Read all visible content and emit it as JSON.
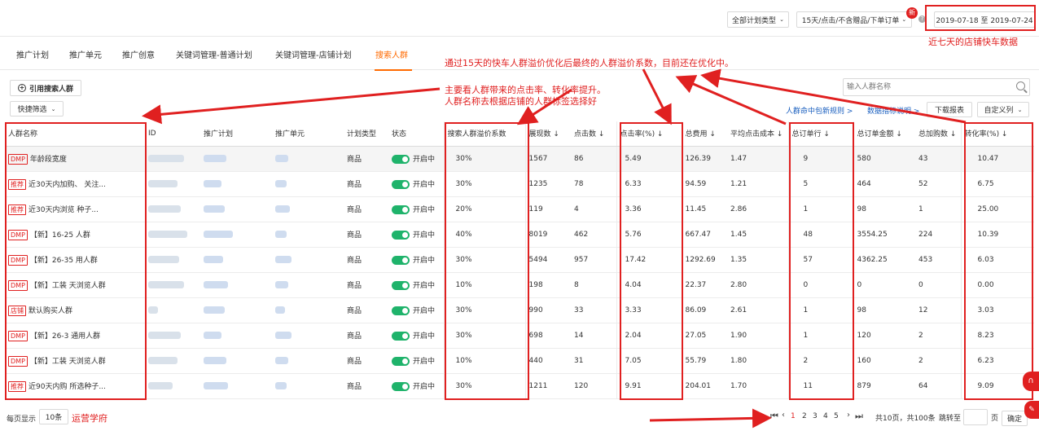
{
  "topbar": {
    "plan_type_select": "全部计划类型",
    "metric_select": "15天/点击/不含赠品/下单订单",
    "new_badge": "新",
    "date_range": "2019-07-18 至 2019-07-24"
  },
  "tabs": [
    "推广计划",
    "推广单元",
    "推广创意",
    "关键词管理-普通计划",
    "关键词管理-店铺计划",
    "搜索人群"
  ],
  "toolbar": {
    "quote_button": "引用搜索人群",
    "quick_filter": "快捷筛选",
    "search_placeholder": "输入人群名称",
    "link_rules": "人群命中包新规则 >",
    "link_metrics": "数据指标说明 >",
    "download_report": "下载报表",
    "custom_columns": "自定义列"
  },
  "table": {
    "headers": [
      "人群名称",
      "ID",
      "推广计划",
      "推广单元",
      "计划类型",
      "状态",
      "搜索人群溢价系数",
      "展现数 ↓",
      "点击数 ↓",
      "点击率(%) ↓",
      "总费用 ↓",
      "平均点击成本 ↓",
      "总订单行 ↓",
      "总订单金额 ↓",
      "总加购数 ↓",
      "转化率(%) ↓"
    ],
    "rows": [
      {
        "tag": "DMP",
        "name": "年龄段宽度",
        "type": "商品",
        "status": "开启中",
        "premium": "30%",
        "impressions": "1567",
        "clicks": "86",
        "ctr": "5.49",
        "cost": "126.39",
        "cpc": "1.47",
        "orders": "9",
        "amount": "580",
        "carts": "43",
        "cvr": "10.47"
      },
      {
        "tag": "推荐",
        "name": "近30天内加购、 关注...",
        "type": "商品",
        "status": "开启中",
        "premium": "30%",
        "impressions": "1235",
        "clicks": "78",
        "ctr": "6.33",
        "cost": "94.59",
        "cpc": "1.21",
        "orders": "5",
        "amount": "464",
        "carts": "52",
        "cvr": "6.75"
      },
      {
        "tag": "推荐",
        "name": "近30天内浏览 种子...",
        "type": "商品",
        "status": "开启中",
        "premium": "20%",
        "impressions": "119",
        "clicks": "4",
        "ctr": "3.36",
        "cost": "11.45",
        "cpc": "2.86",
        "orders": "1",
        "amount": "98",
        "carts": "1",
        "cvr": "25.00"
      },
      {
        "tag": "DMP",
        "name": "【新】16-25 人群",
        "type": "商品",
        "status": "开启中",
        "premium": "40%",
        "impressions": "8019",
        "clicks": "462",
        "ctr": "5.76",
        "cost": "667.47",
        "cpc": "1.45",
        "orders": "48",
        "amount": "3554.25",
        "carts": "224",
        "cvr": "10.39"
      },
      {
        "tag": "DMP",
        "name": "【新】26-35 用人群",
        "type": "商品",
        "status": "开启中",
        "premium": "30%",
        "impressions": "5494",
        "clicks": "957",
        "ctr": "17.42",
        "cost": "1292.69",
        "cpc": "1.35",
        "orders": "57",
        "amount": "4362.25",
        "carts": "453",
        "cvr": "6.03"
      },
      {
        "tag": "DMP",
        "name": "【新】工装 天浏览人群",
        "type": "商品",
        "status": "开启中",
        "premium": "10%",
        "impressions": "198",
        "clicks": "8",
        "ctr": "4.04",
        "cost": "22.37",
        "cpc": "2.80",
        "orders": "0",
        "amount": "0",
        "carts": "0",
        "cvr": "0.00"
      },
      {
        "tag": "店铺",
        "name": "默认购买人群",
        "type": "商品",
        "status": "开启中",
        "premium": "30%",
        "impressions": "990",
        "clicks": "33",
        "ctr": "3.33",
        "cost": "86.09",
        "cpc": "2.61",
        "orders": "1",
        "amount": "98",
        "carts": "12",
        "cvr": "3.03"
      },
      {
        "tag": "DMP",
        "name": "【新】26-3 通用人群",
        "type": "商品",
        "status": "开启中",
        "premium": "30%",
        "impressions": "698",
        "clicks": "14",
        "ctr": "2.04",
        "cost": "27.05",
        "cpc": "1.90",
        "orders": "1",
        "amount": "120",
        "carts": "2",
        "cvr": "8.23"
      },
      {
        "tag": "DMP",
        "name": "【新】工装 天浏览人群",
        "type": "商品",
        "status": "开启中",
        "premium": "10%",
        "impressions": "440",
        "clicks": "31",
        "ctr": "7.05",
        "cost": "55.79",
        "cpc": "1.80",
        "orders": "2",
        "amount": "160",
        "carts": "2",
        "cvr": "6.23"
      },
      {
        "tag": "推荐",
        "name": "近90天内购 所选种子...",
        "type": "商品",
        "status": "开启中",
        "premium": "30%",
        "impressions": "1211",
        "clicks": "120",
        "ctr": "9.91",
        "cost": "204.01",
        "cpc": "1.70",
        "orders": "11",
        "amount": "879",
        "carts": "64",
        "cvr": "9.09"
      }
    ]
  },
  "footer": {
    "per_page_label": "每页显示",
    "per_page_value": "10条",
    "watermark": "运营学府",
    "pages": [
      "1",
      "2",
      "3",
      "4",
      "5"
    ],
    "summary": "共10页，共100条",
    "jump_label": "跳转至",
    "page_unit": "页",
    "confirm": "确定"
  },
  "annotations": {
    "shop_data_note": "近七天的店铺快车数据",
    "premium_note": "通过15天的快车人群溢价优化后最终的人群溢价系数，目前还在优化中。",
    "ctr_note_line1": "主要看人群带来的点击率、转化率提升。",
    "ctr_note_line2": "人群名称去根据店铺的人群标签选择好"
  },
  "colors": {
    "accent": "#ff6a00",
    "annotation_red": "#e02020",
    "toggle_green": "#1fb36b"
  }
}
